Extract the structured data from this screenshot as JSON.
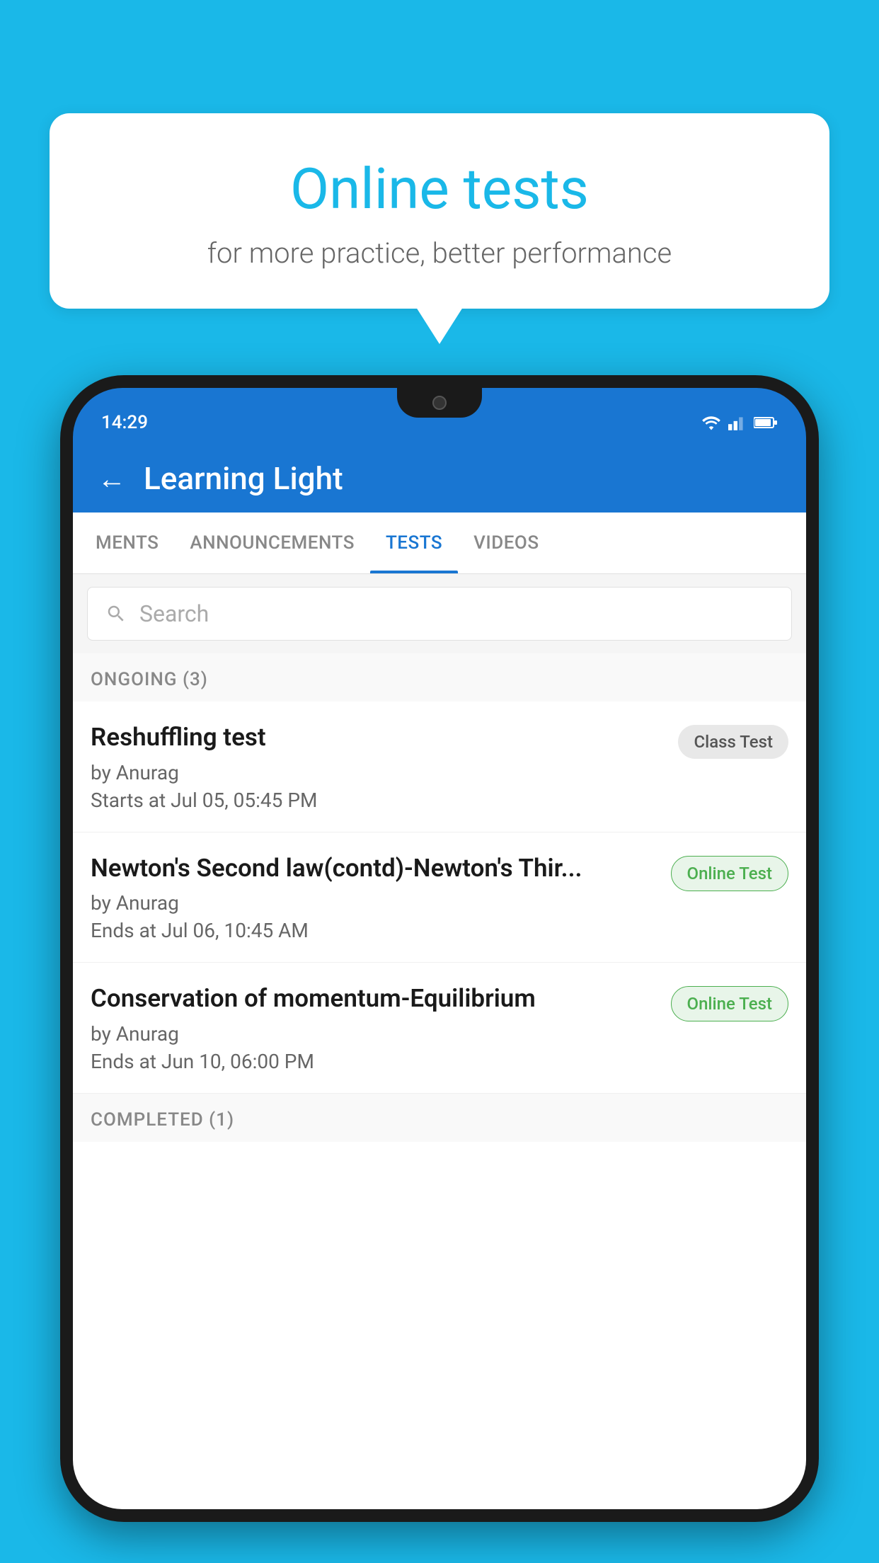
{
  "background_color": "#1AB8E8",
  "bubble": {
    "title": "Online tests",
    "subtitle": "for more practice, better performance"
  },
  "phone": {
    "status_bar": {
      "time": "14:29"
    },
    "app_bar": {
      "title": "Learning Light",
      "back_label": "←"
    },
    "tabs": [
      {
        "label": "MENTS",
        "active": false
      },
      {
        "label": "ANNOUNCEMENTS",
        "active": false
      },
      {
        "label": "TESTS",
        "active": true
      },
      {
        "label": "VIDEOS",
        "active": false
      }
    ],
    "search": {
      "placeholder": "Search"
    },
    "ongoing_section": {
      "header": "ONGOING (3)",
      "items": [
        {
          "title": "Reshuffling test",
          "author": "by Anurag",
          "date": "Starts at  Jul 05, 05:45 PM",
          "badge": "Class Test",
          "badge_type": "class"
        },
        {
          "title": "Newton's Second law(contd)-Newton's Thir...",
          "author": "by Anurag",
          "date": "Ends at  Jul 06, 10:45 AM",
          "badge": "Online Test",
          "badge_type": "online"
        },
        {
          "title": "Conservation of momentum-Equilibrium",
          "author": "by Anurag",
          "date": "Ends at  Jun 10, 06:00 PM",
          "badge": "Online Test",
          "badge_type": "online"
        }
      ]
    },
    "completed_section": {
      "header": "COMPLETED (1)"
    }
  }
}
